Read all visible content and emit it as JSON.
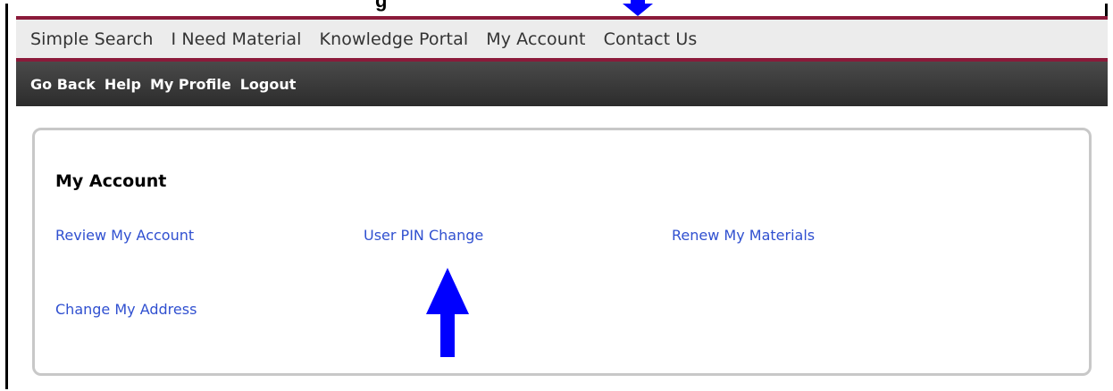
{
  "heading_fragment": "g",
  "nav_primary": [
    "Simple Search",
    "I Need Material",
    "Knowledge Portal",
    "My Account",
    "Contact Us"
  ],
  "nav_secondary": [
    "Go Back",
    "Help",
    "My Profile",
    "Logout"
  ],
  "panel": {
    "title": "My Account",
    "links": {
      "review": "Review My Account",
      "pin": "User PIN Change",
      "renew": "Renew My Materials",
      "address": "Change My Address"
    }
  },
  "colors": {
    "accent_maroon": "#8b1a3a",
    "link_blue": "#3050d0",
    "annotation_arrow": "#0000ff",
    "secondary_bar": "#3a3a3a"
  },
  "icons": [
    "arrow-down-annotation-icon",
    "arrow-up-annotation-icon"
  ]
}
